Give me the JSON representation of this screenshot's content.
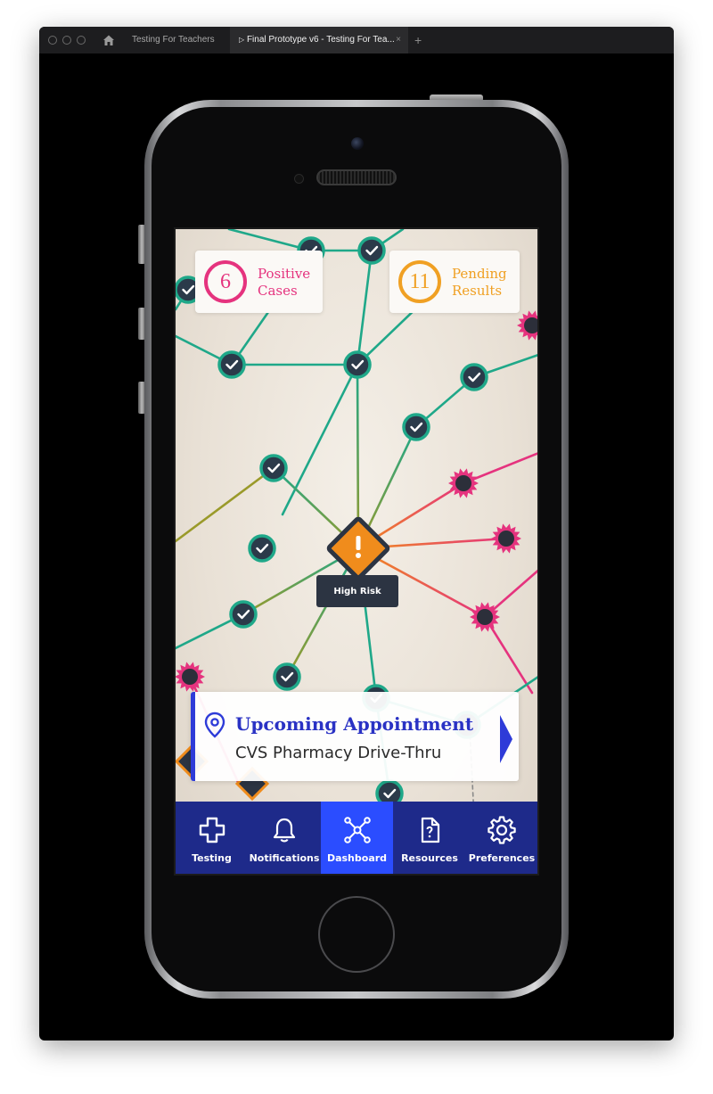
{
  "browser": {
    "tabs": [
      {
        "label": "Testing For Teachers"
      },
      {
        "label": "Final Prototype v6 - Testing For Tea..."
      }
    ]
  },
  "stats": {
    "positive": {
      "count": "6",
      "line1": "Positive",
      "line2": "Cases",
      "color": "#e5337e"
    },
    "pending": {
      "count": "11",
      "line1": "Pending",
      "line2": "Results",
      "color": "#f0a023"
    }
  },
  "network": {
    "safe_color": "#1fa889",
    "infected_color": "#e5337e",
    "risk_color": "#f08c1c",
    "high_risk_label": "High Risk"
  },
  "appointment": {
    "title": "Upcoming Appointment",
    "location": "CVS Pharmacy Drive-Thru",
    "accent": "#2e3bd8"
  },
  "nav": {
    "background": "#1e2a8a",
    "active_color": "#2b4dff",
    "items": [
      {
        "label": "Testing",
        "icon": "medical-cross-icon",
        "active": false
      },
      {
        "label": "Notifications",
        "icon": "bell-icon",
        "active": false
      },
      {
        "label": "Dashboard",
        "icon": "network-icon",
        "active": true
      },
      {
        "label": "Resources",
        "icon": "document-question-icon",
        "active": false
      },
      {
        "label": "Preferences",
        "icon": "gear-icon",
        "active": false
      }
    ]
  }
}
